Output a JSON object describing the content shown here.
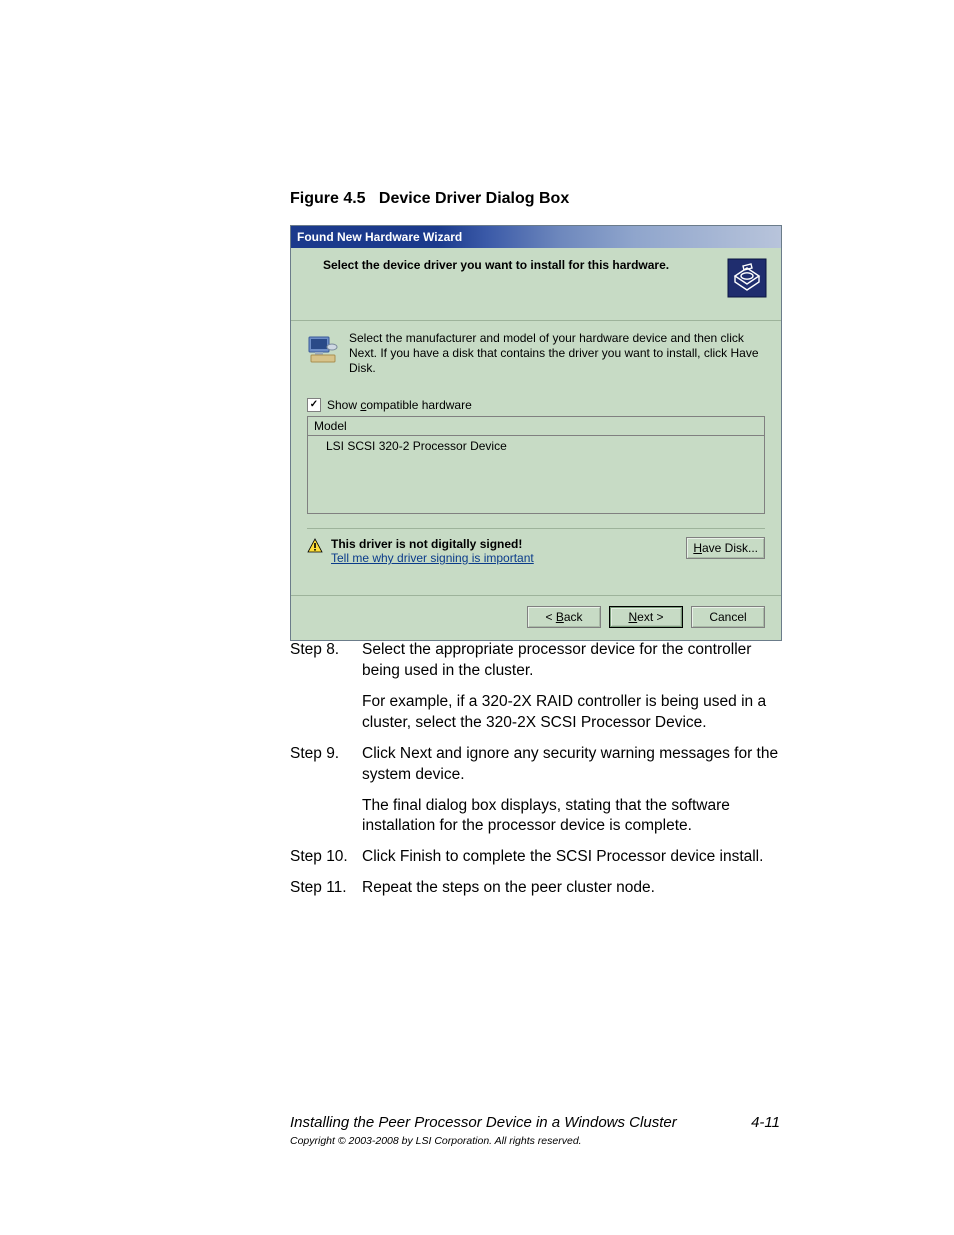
{
  "figure": {
    "label": "Figure 4.5",
    "title": "Device Driver Dialog Box"
  },
  "dialog": {
    "title": "Found New Hardware Wizard",
    "header_text": "Select the device driver you want to install for this hardware.",
    "instruction_text": "Select the manufacturer and model of your hardware device and then click Next. If you have a disk that contains the driver you want to install, click Have Disk.",
    "show_compatible_label_pre": "Show ",
    "show_compatible_label_u": "c",
    "show_compatible_label_post": "ompatible hardware",
    "show_compatible_checked": true,
    "model_header": "Model",
    "model_items": [
      "LSI SCSI 320-2 Processor Device"
    ],
    "signing_bold": "This driver is not digitally signed!",
    "signing_link": "Tell me why driver signing is important",
    "have_disk_u": "H",
    "have_disk_post": "ave Disk...",
    "back_pre": "< ",
    "back_u": "B",
    "back_post": "ack",
    "next_u": "N",
    "next_post": "ext >",
    "cancel": "Cancel"
  },
  "steps": {
    "s8_label": "Step 8.",
    "s8_text": "Select the appropriate processor device for the controller being used in the cluster.",
    "s8_cont": "For example, if a 320-2X RAID controller is being used in a cluster, select the 320-2X SCSI Processor Device.",
    "s9_label": "Step 9.",
    "s9_text": "Click Next and ignore any security warning messages for the system device.",
    "s9_cont": "The final dialog box displays, stating that the software installation for the processor device is complete.",
    "s10_label": "Step 10.",
    "s10_text": "Click Finish to complete the SCSI Processor device install.",
    "s11_label": "Step 11.",
    "s11_text": "Repeat the steps on the peer cluster node."
  },
  "footer": {
    "section": "Installing the Peer Processor Device in a Windows Cluster",
    "page_num": "4-11",
    "copyright": "Copyright © 2003-2008 by LSI Corporation. All rights reserved."
  }
}
